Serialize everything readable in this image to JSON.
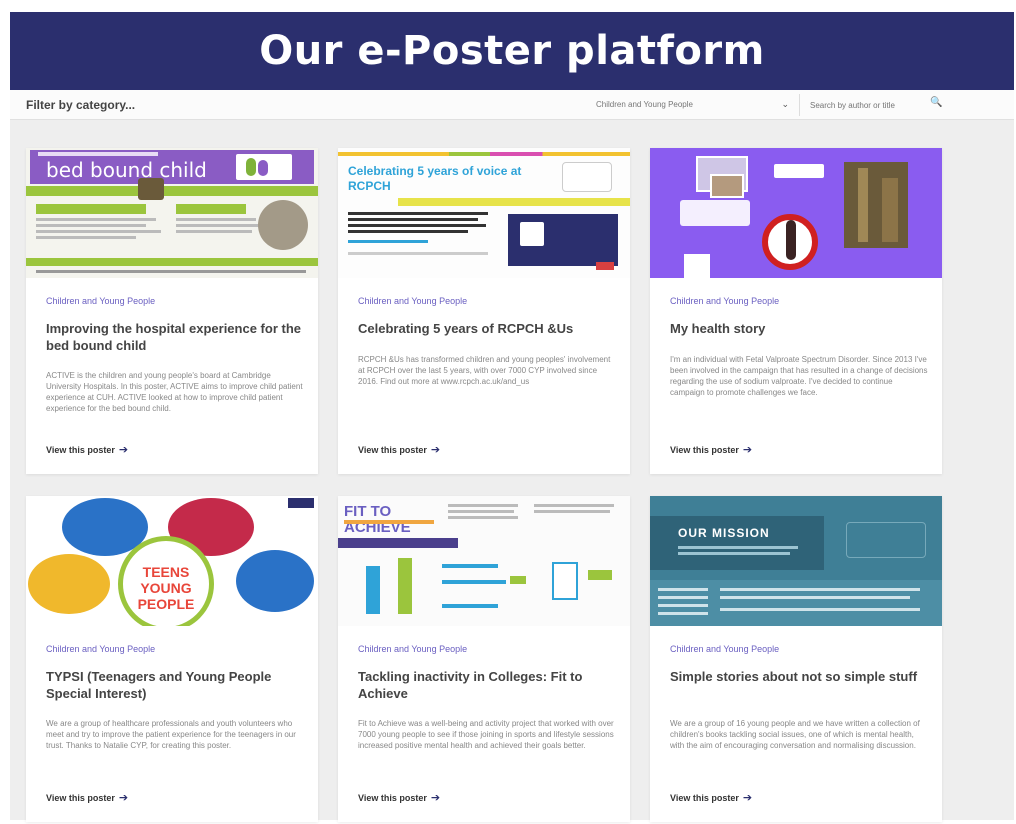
{
  "banner": {
    "title": "Our e-Poster platform"
  },
  "filter": {
    "label": "Filter by category...",
    "selected": "Children and Young People",
    "search_placeholder": "Search by author or title"
  },
  "cards": [
    {
      "category": "Children and Young People",
      "title": "Improving the hospital experience for the bed bound child",
      "description": "ACTIVE is the children and young people's board at Cambridge University Hospitals. In this poster, ACTIVE aims to improve child patient experience at CUH. ACTIVE looked at how to improve child patient experience for the bed bound child.",
      "cta": "View this poster",
      "thumb_heading": "bed bound child"
    },
    {
      "category": "Children and Young People",
      "title": "Celebrating 5 years of RCPCH &Us",
      "description": "RCPCH &Us has transformed children and young peoples' involvement at RCPCH over the last 5 years, with over 7000 CYP involved since 2016. Find out more at www.rcpch.ac.uk/and_us",
      "cta": "View this poster",
      "thumb_heading": "Celebrating 5 years of voice at RCPCH"
    },
    {
      "category": "Children and Young People",
      "title": "My health story",
      "description": "I'm an individual with Fetal Valproate Spectrum Disorder. Since 2013 I've been involved in the campaign that has resulted in a change of decisions regarding the use of sodium valproate. I've decided to continue campaign to promote challenges we face.",
      "cta": "View this poster",
      "thumb_heading": ""
    },
    {
      "category": "Children and Young People",
      "title": "TYPSI (Teenagers and Young People Special Interest)",
      "description": "We are a group of healthcare professionals and youth volunteers who meet and try to improve the patient experience for the teenagers in our trust. Thanks to Natalie CYP, for creating this poster.",
      "cta": "View this poster",
      "thumb_heading": "TEENS YOUNG PEOPLE"
    },
    {
      "category": "Children and Young People",
      "title": "Tackling inactivity in Colleges: Fit to Achieve",
      "description": "Fit to Achieve was a well-being and activity project that worked with over 7000 young people to see if those joining in sports and lifestyle sessions increased positive mental health and achieved their goals better.",
      "cta": "View this poster",
      "thumb_heading": "FIT TO ACHIEVE"
    },
    {
      "category": "Children and Young People",
      "title": "Simple stories about not so simple stuff",
      "description": "We are a group of 16 young people and we have written a collection of children's books tackling social issues, one of which is mental health, with the aim of encouraging conversation and normalising discussion.",
      "cta": "View this poster",
      "thumb_heading": "OUR MISSION"
    }
  ],
  "colors": {
    "banner": "#2b2f6e",
    "accent_purple": "#8a5cf0",
    "accent_green": "#9bc53d",
    "accent_teal": "#3f7f96",
    "category_text": "#6a5fc1"
  }
}
